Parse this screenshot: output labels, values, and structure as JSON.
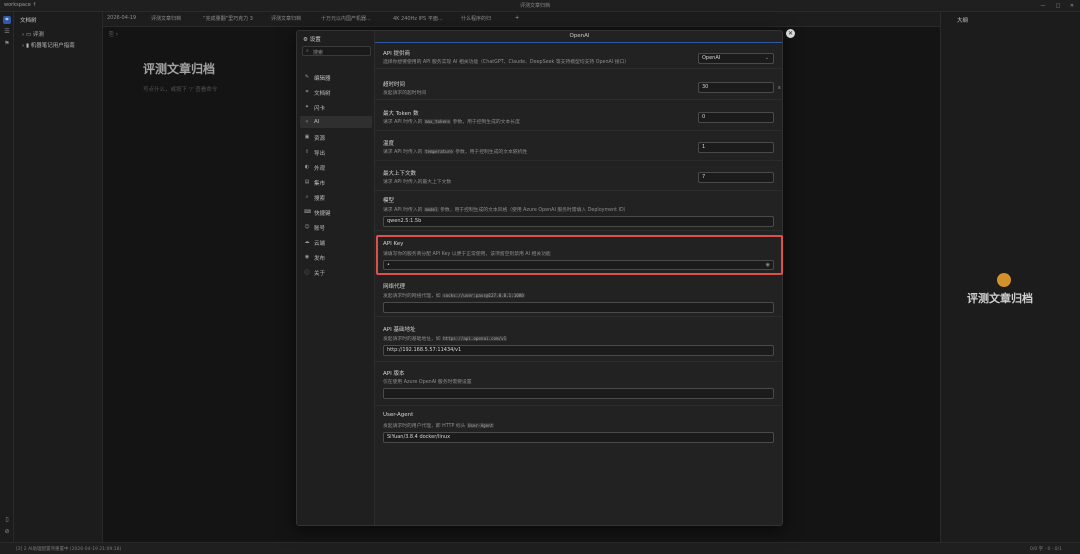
{
  "window": {
    "workspace": "workspace ↑",
    "title": "评测文章归档",
    "controls": [
      "—",
      "□",
      "✕"
    ]
  },
  "sidebar": {
    "header": "文档树",
    "items": [
      "评测",
      "机器笔记用户指南"
    ]
  },
  "tabs": [
    "2026-04-19",
    "评测文章归档",
    "“完成量翻”里巧克力 3",
    "评测文章归档",
    "十万元以内国产机器...",
    "4K 240Hz IPS 平面...",
    "什么程序的归"
  ],
  "tab_add": "+",
  "editor": {
    "breadcrumb": "⎘ ›",
    "title": "评测文章归档",
    "placeholder": "写点什么，或按下 '/' 查看命令"
  },
  "outline": {
    "header": "大纲",
    "title": "评测文章归档",
    "accent_color": "#d4902a"
  },
  "status": {
    "left": "[2] 2 AI助理配置项重置中 (2026-04-19 21:09:18)",
    "right": "0/0 字 · 0 · 0/1"
  },
  "settings": {
    "header": "设置",
    "search_placeholder": "搜索",
    "nav": [
      {
        "icon": "pencil-icon",
        "glyph": "✎",
        "label": "编辑器"
      },
      {
        "icon": "tree-icon",
        "glyph": "⌗",
        "label": "文档树"
      },
      {
        "icon": "flashcard-icon",
        "glyph": "✦",
        "label": "闪卡"
      },
      {
        "icon": "ai-icon",
        "glyph": "✧",
        "label": "AI",
        "active": true
      },
      {
        "icon": "image-icon",
        "glyph": "▣",
        "label": "资源"
      },
      {
        "icon": "export-icon",
        "glyph": "⇪",
        "label": "导出"
      },
      {
        "icon": "appearance-icon",
        "glyph": "◐",
        "label": "外观"
      },
      {
        "icon": "bazaar-icon",
        "glyph": "▤",
        "label": "集市"
      },
      {
        "icon": "search-icon",
        "glyph": "⌕",
        "label": "搜索"
      },
      {
        "icon": "keymap-icon",
        "glyph": "⌨",
        "label": "快捷键"
      },
      {
        "icon": "account-icon",
        "glyph": "☺",
        "label": "账号"
      },
      {
        "icon": "cloud-icon",
        "glyph": "☁",
        "label": "云端"
      },
      {
        "icon": "publish-icon",
        "glyph": "◉",
        "label": "发布"
      },
      {
        "icon": "info-icon",
        "glyph": "ⓘ",
        "label": "关于"
      }
    ],
    "content_title": "OpenAI",
    "rows": {
      "provider": {
        "title": "API 提供商",
        "desc": "选择你想要使用的 API 服务实现 AI 相关功能（ChatGPT、Claude、DeepSeek 等支持模型均支持 OpenAI 接口）",
        "value": "OpenAI"
      },
      "timeout": {
        "title": "超时时间",
        "desc": "发起请求的超时时间",
        "value": "30",
        "unit": "s"
      },
      "max_tokens": {
        "title": "最大 Token 数",
        "desc_pre": "请求 API 时传入的",
        "code": "max_tokens",
        "desc_post": "参数，用于控制生成的文本长度",
        "value": "0"
      },
      "temperature": {
        "title": "温度",
        "desc_pre": "请求 API 时传入的",
        "code": "temperature",
        "desc_post": "参数，用于控制生成的文本随机性",
        "value": "1"
      },
      "max_context": {
        "title": "最大上下文数",
        "desc": "请求 API 时传入的最大上下文数",
        "value": "7"
      },
      "model": {
        "title": "模型",
        "desc_pre": "请求 API 时传入的",
        "code": "model",
        "desc_post": "参数，用于控制生成的文本风格（使用 Azure OpenAI 服务时需填入 Deployment ID）",
        "value": "qwen2.5:1.5b"
      },
      "api_key": {
        "title": "API Key",
        "desc": "请填写你的服务商分配 API Key 以便于正常使用，该项留空则禁用 AI 相关功能",
        "value": "•",
        "eye": "◉"
      },
      "proxy": {
        "title": "网络代理",
        "desc_pre": "发起请求时的网络代理，如",
        "code": "socks://user:pass@127.0.0.1:1080",
        "value": ""
      },
      "base_url": {
        "title": "API 基础地址",
        "desc_pre": "发起请求时的基础地址，如",
        "code": "https://api.openai.com/v1",
        "value": "http://192.168.5.57:11434/v1"
      },
      "api_version": {
        "title": "API 版本",
        "desc": "仅在使用 Azure OpenAI 服务时需要设置",
        "value": ""
      },
      "user_agent": {
        "title": "User-Agent",
        "desc_pre": "发起请求时的用户代理，即 HTTP 标头",
        "code": "User-Agent",
        "value": "SiYuan/3.8.4 docker/linux"
      }
    },
    "highlight_color": "#e0504a",
    "accent_color": "#2f5aa8"
  }
}
